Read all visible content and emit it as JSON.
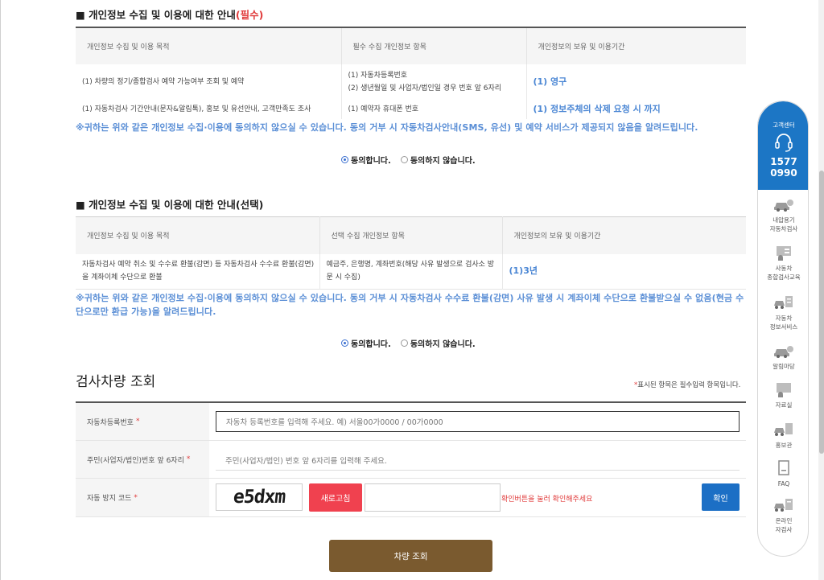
{
  "section1": {
    "title": "■ 개인정보 수집 및 이용에 대한 안내",
    "title_required": "(필수)",
    "headers": [
      "개인정보 수집 및 이용 목적",
      "필수 수집 개인정보 항목",
      "개인정보의 보유 및 이용기간"
    ],
    "rows": [
      {
        "purpose": "(1) 차량의 정기/종합검사 예약 가능여부 조회 및 예약",
        "items": [
          "(1) 자동차등록번호",
          "(2) 생년월일 및 사업자/법인일 경우 번호 앞 6자리"
        ],
        "period": "(1) 영구"
      },
      {
        "purpose": "(1) 자동차검사 기간안내(문자&알림톡), 홍보 및 유선안내, 고객만족도 조사",
        "items": [
          "(1) 예약자 휴대폰 번호"
        ],
        "period": "(1) 정보주체의 삭제 요청 시 까지"
      }
    ],
    "notice": "※귀하는 위와 같은 개인정보 수집·이용에 동의하지 않으실 수 있습니다. 동의 거부 시 자동차검사안내(SMS, 유선) 및 예약 서비스가 제공되지 않음을 알려드립니다.",
    "agree": "동의합니다.",
    "disagree": "동의하지 않습니다."
  },
  "section2": {
    "title": "■ 개인정보 수집 및 이용에 대한 안내(선택)",
    "headers": [
      "개인정보 수집 및 이용 목적",
      "선택 수집 개인정보 항목",
      "개인정보의 보유 및 이용기간"
    ],
    "row": {
      "purpose": "자동차검사 예약 취소 및 수수료 환불(감면) 등 자동차검사 수수료 환불(감면)을 계좌이체 수단으로 환불",
      "items": "예금주, 은행명, 계좌번호(해당 사유 발생으로 검사소 방문 시 수집)",
      "period": "(1)3년"
    },
    "notice": "※귀하는 위와 같은 개인정보 수집·이용에 동의하지 않으실 수 있습니다. 동의 거부 시 자동차검사 수수료 환불(감면) 사유 발생 시 계좌이체 수단으로 환불받으실 수 없음(현금 수단으로만 환급 가능)을 알려드립니다.",
    "agree": "동의합니다.",
    "disagree": "동의하지 않습니다."
  },
  "lookup": {
    "title": "검사차량 조회",
    "req_note_star": "*",
    "req_note": "표시된 항목은 필수입력 항목입니다.",
    "plate_label": "자동차등록번호",
    "plate_placeholder": "자동차 등록번호를 입력해 주세요. 예) 서울00가0000 / 00가0000",
    "id_label": "주민(사업자/법인)번호 앞 6자리",
    "id_placeholder": "주민(사업자/법인) 번호 앞 6자리를 입력해 주세요.",
    "captcha_label": "자동 방지 코드",
    "captcha_text": "e5dxm",
    "refresh": "새로고침",
    "captcha_msg": "확인버튼을 눌러 확인해주세요",
    "confirm": "확인",
    "submit": "차량 조회",
    "star": "*"
  },
  "side": {
    "cs_label": "고객센터",
    "phone1": "1577",
    "phone2": "0990",
    "items": [
      {
        "l1": "내압용기",
        "l2": "자동차검사",
        "icon": "car-icon"
      },
      {
        "l1": "사동차",
        "l2": "종합검사교육",
        "icon": "education-icon"
      },
      {
        "l1": "자동차",
        "l2": "정보서비스",
        "icon": "info-service-icon"
      },
      {
        "l1": "알림마당",
        "l2": "",
        "icon": "notice-car-icon"
      },
      {
        "l1": "자료실",
        "l2": "",
        "icon": "archive-icon"
      },
      {
        "l1": "홍보관",
        "l2": "",
        "icon": "promo-icon"
      },
      {
        "l1": "FAQ",
        "l2": "",
        "icon": "faq-icon"
      },
      {
        "l1": "온라인",
        "l2": "자검사",
        "icon": "online-icon"
      }
    ]
  },
  "colors": {
    "accent_blue": "#1c76c5",
    "notice_blue": "#5b8fd6",
    "submit_brown": "#7a5a2f",
    "refresh_red": "#f0414f",
    "confirm_blue": "#1c6fc5"
  }
}
